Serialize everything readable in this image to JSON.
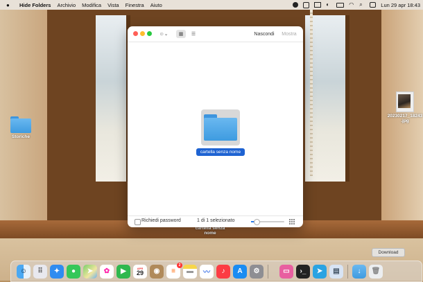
{
  "menubar": {
    "app_name": "Hide Folders",
    "menus": [
      "Archivio",
      "Modifica",
      "Vista",
      "Finestra",
      "Aiuto"
    ],
    "datetime": "Lun 29 apr 18:43"
  },
  "desktop": {
    "folder_label": "Storiche",
    "image_label_line1": "20230217_18243",
    "image_label_line2": ".jpg",
    "ghost_label_line1": "cartella senza",
    "ghost_label_line2": "nome"
  },
  "window": {
    "hide_label": "Nascondi",
    "show_label": "Mostra",
    "selected_folder_label": "cartella senza nome",
    "password_label": "Richiedi password",
    "selection_count": "1 di 1 selezionato",
    "zoom_slider_value": 0.15
  },
  "tooltip": {
    "text": "Download"
  },
  "dock": {
    "calendar_month": "APR",
    "calendar_day": "29",
    "reminders_badge": "2"
  },
  "colors": {
    "selection_blue": "#1e63d2",
    "folder_blue": "#3e9be0"
  }
}
